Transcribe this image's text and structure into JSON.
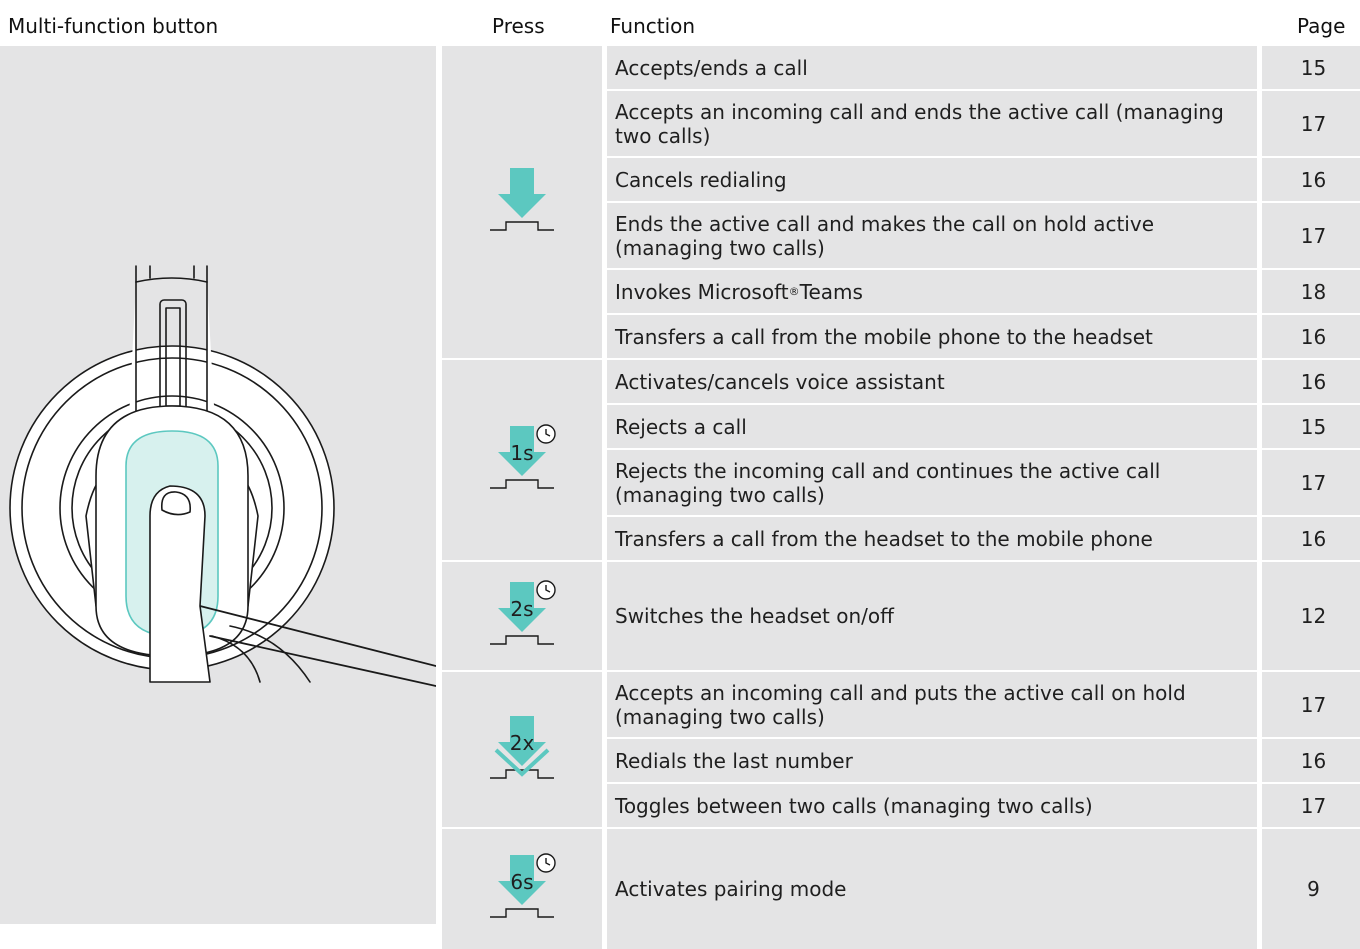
{
  "header": {
    "title": "Multi-function button",
    "press": "Press",
    "function": "Function",
    "page": "Page"
  },
  "colors": {
    "accent": "#5cc8c0",
    "cell_bg": "#e4e4e5"
  },
  "groups": [
    {
      "icon": "press-arrow-icon",
      "label": "",
      "rows": [
        {
          "function": "Accepts/ends a call",
          "page": "15"
        },
        {
          "function": "Accepts an incoming call and ends the active call (managing two calls)",
          "page": "17"
        },
        {
          "function": "Cancels redialing",
          "page": "16"
        },
        {
          "function": "Ends the active call and makes the call on hold active (managing two calls)",
          "page": "17"
        },
        {
          "function": "Invokes Microsoft® Teams",
          "page": "18"
        },
        {
          "function": "Transfers a call from the mobile phone to the headset",
          "page": "16"
        }
      ]
    },
    {
      "icon": "press-hold-arrow-icon",
      "label": "1s",
      "rows": [
        {
          "function": "Activates/cancels voice assistant",
          "page": "16"
        },
        {
          "function": "Rejects a call",
          "page": "15"
        },
        {
          "function": "Rejects the incoming call and continues the active call (managing two calls)",
          "page": "17"
        },
        {
          "function": "Transfers a call from the headset to the mobile phone",
          "page": "16"
        }
      ]
    },
    {
      "icon": "press-hold-arrow-icon",
      "label": "2s",
      "rows": [
        {
          "function": "Switches the headset on/off",
          "page": "12"
        }
      ]
    },
    {
      "icon": "double-press-arrow-icon",
      "label": "2x",
      "rows": [
        {
          "function": "Accepts an incoming call and puts the active call on hold (managing two calls)",
          "page": "17"
        },
        {
          "function": "Redials the last number",
          "page": "16"
        },
        {
          "function": "Toggles between two calls (managing two calls)",
          "page": "17"
        }
      ]
    },
    {
      "icon": "press-hold-arrow-icon",
      "label": "6s",
      "rows": [
        {
          "function": "Activates pairing mode",
          "page": "9"
        }
      ]
    }
  ]
}
